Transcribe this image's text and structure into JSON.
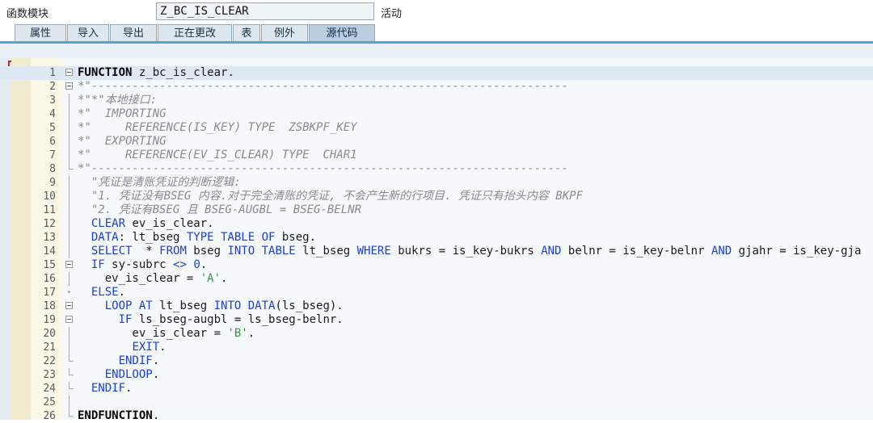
{
  "header": {
    "label": "函数模块",
    "function_name": "Z_BC_IS_CLEAR",
    "status": "活动"
  },
  "tabs": [
    {
      "label": "属性",
      "active": false
    },
    {
      "label": "导入",
      "active": false
    },
    {
      "label": "导出",
      "active": false
    },
    {
      "label": "正在更改",
      "active": false
    },
    {
      "label": "表",
      "active": false
    },
    {
      "label": "例外",
      "active": false
    },
    {
      "label": "源代码",
      "active": true
    }
  ],
  "colors": {
    "keyword": "#1a3fd6",
    "comment": "#8a8a8a",
    "string": "#2e9a3a",
    "gutter": "#fbf8e8",
    "tab_active": "#b9cedf"
  },
  "code": {
    "current_line": 1,
    "lines": [
      {
        "n": "1",
        "fold": "box",
        "tokens": [
          {
            "t": "FUNCTION",
            "c": "bold"
          },
          {
            "t": " z_bc_is_clear.",
            "c": ""
          }
        ]
      },
      {
        "n": "2",
        "fold": "box",
        "tokens": [
          {
            "t": "*\"----------------------------------------------------------------------",
            "c": "cmt"
          }
        ]
      },
      {
        "n": "3",
        "fold": "vline",
        "tokens": [
          {
            "t": "*\"*\"本地接口:",
            "c": "cmt"
          }
        ]
      },
      {
        "n": "4",
        "fold": "vline",
        "tokens": [
          {
            "t": "*\"  IMPORTING",
            "c": "cmt"
          }
        ]
      },
      {
        "n": "5",
        "fold": "vline",
        "tokens": [
          {
            "t": "*\"     REFERENCE(IS_KEY) TYPE  ZSBKPF_KEY",
            "c": "cmt"
          }
        ]
      },
      {
        "n": "6",
        "fold": "vline",
        "tokens": [
          {
            "t": "*\"  EXPORTING",
            "c": "cmt"
          }
        ]
      },
      {
        "n": "7",
        "fold": "vline",
        "tokens": [
          {
            "t": "*\"     REFERENCE(EV_IS_CLEAR) TYPE  CHAR1",
            "c": "cmt"
          }
        ]
      },
      {
        "n": "8",
        "fold": "end",
        "tokens": [
          {
            "t": "*\"----------------------------------------------------------------------",
            "c": "cmt"
          }
        ]
      },
      {
        "n": "9",
        "fold": "vline",
        "tokens": [
          {
            "t": "  \"凭证是清账凭证的判断逻辑:",
            "c": "cmt"
          }
        ]
      },
      {
        "n": "10",
        "fold": "vline",
        "tokens": [
          {
            "t": "  \"1. 凭证没有BSEG 内容.对于完全清账的凭证, 不会产生新的行项目. 凭证只有抬头内容 BKPF",
            "c": "cmt"
          }
        ]
      },
      {
        "n": "11",
        "fold": "vline",
        "tokens": [
          {
            "t": "  \"2. 凭证有BSEG 且 BSEG-AUGBL = BSEG-BELNR",
            "c": "cmt"
          }
        ]
      },
      {
        "n": "12",
        "fold": "vline",
        "tokens": [
          {
            "t": "  ",
            "c": ""
          },
          {
            "t": "CLEAR",
            "c": "blue"
          },
          {
            "t": " ev_is_clear.",
            "c": ""
          }
        ]
      },
      {
        "n": "13",
        "fold": "vline",
        "tokens": [
          {
            "t": "  ",
            "c": ""
          },
          {
            "t": "DATA",
            "c": "blue"
          },
          {
            "t": ": lt_bseg ",
            "c": ""
          },
          {
            "t": "TYPE TABLE OF",
            "c": "blue"
          },
          {
            "t": " bseg.",
            "c": ""
          }
        ]
      },
      {
        "n": "14",
        "fold": "vline",
        "tokens": [
          {
            "t": "  ",
            "c": ""
          },
          {
            "t": "SELECT",
            "c": "blue"
          },
          {
            "t": "  * ",
            "c": ""
          },
          {
            "t": "FROM",
            "c": "blue"
          },
          {
            "t": " bseg ",
            "c": ""
          },
          {
            "t": "INTO TABLE",
            "c": "blue"
          },
          {
            "t": " lt_bseg ",
            "c": ""
          },
          {
            "t": "WHERE",
            "c": "blue"
          },
          {
            "t": " bukrs = is_key-bukrs ",
            "c": ""
          },
          {
            "t": "AND",
            "c": "blue"
          },
          {
            "t": " belnr = is_key-belnr ",
            "c": ""
          },
          {
            "t": "AND",
            "c": "blue"
          },
          {
            "t": " gjahr = is_key-gjahr.",
            "c": ""
          }
        ]
      },
      {
        "n": "15",
        "fold": "box",
        "tokens": [
          {
            "t": "  ",
            "c": ""
          },
          {
            "t": "IF",
            "c": "blue"
          },
          {
            "t": " sy-subrc ",
            "c": ""
          },
          {
            "t": "<>",
            "c": "blue"
          },
          {
            "t": " ",
            "c": ""
          },
          {
            "t": "0",
            "c": "num"
          },
          {
            "t": ".",
            "c": ""
          }
        ]
      },
      {
        "n": "16",
        "fold": "vline",
        "tokens": [
          {
            "t": "    ev_is_clear = ",
            "c": ""
          },
          {
            "t": "'A'",
            "c": "str"
          },
          {
            "t": ".",
            "c": ""
          }
        ]
      },
      {
        "n": "17",
        "fold": "dot",
        "tokens": [
          {
            "t": "  ",
            "c": ""
          },
          {
            "t": "ELSE",
            "c": "blue"
          },
          {
            "t": ".",
            "c": ""
          }
        ]
      },
      {
        "n": "18",
        "fold": "box",
        "tokens": [
          {
            "t": "    ",
            "c": ""
          },
          {
            "t": "LOOP AT",
            "c": "blue"
          },
          {
            "t": " lt_bseg ",
            "c": ""
          },
          {
            "t": "INTO DATA",
            "c": "blue"
          },
          {
            "t": "(ls_bseg).",
            "c": ""
          }
        ]
      },
      {
        "n": "19",
        "fold": "box",
        "tokens": [
          {
            "t": "      ",
            "c": ""
          },
          {
            "t": "IF",
            "c": "blue"
          },
          {
            "t": " ls_bseg-augbl = ls_bseg-belnr.",
            "c": ""
          }
        ]
      },
      {
        "n": "20",
        "fold": "vline",
        "tokens": [
          {
            "t": "        ev_is_clear = ",
            "c": ""
          },
          {
            "t": "'B'",
            "c": "str"
          },
          {
            "t": ".",
            "c": ""
          }
        ]
      },
      {
        "n": "21",
        "fold": "vline",
        "tokens": [
          {
            "t": "        ",
            "c": ""
          },
          {
            "t": "EXIT",
            "c": "blue"
          },
          {
            "t": ".",
            "c": ""
          }
        ]
      },
      {
        "n": "22",
        "fold": "end",
        "tokens": [
          {
            "t": "      ",
            "c": ""
          },
          {
            "t": "ENDIF",
            "c": "blue"
          },
          {
            "t": ".",
            "c": ""
          }
        ]
      },
      {
        "n": "23",
        "fold": "end",
        "tokens": [
          {
            "t": "    ",
            "c": ""
          },
          {
            "t": "ENDLOOP",
            "c": "blue"
          },
          {
            "t": ".",
            "c": ""
          }
        ]
      },
      {
        "n": "24",
        "fold": "end",
        "tokens": [
          {
            "t": "  ",
            "c": ""
          },
          {
            "t": "ENDIF",
            "c": "blue"
          },
          {
            "t": ".",
            "c": ""
          }
        ]
      },
      {
        "n": "25",
        "fold": "vline",
        "tokens": []
      },
      {
        "n": "26",
        "fold": "end",
        "tokens": [
          {
            "t": "ENDFUNCTION",
            "c": "bold"
          },
          {
            "t": ".",
            "c": ""
          }
        ]
      }
    ]
  }
}
